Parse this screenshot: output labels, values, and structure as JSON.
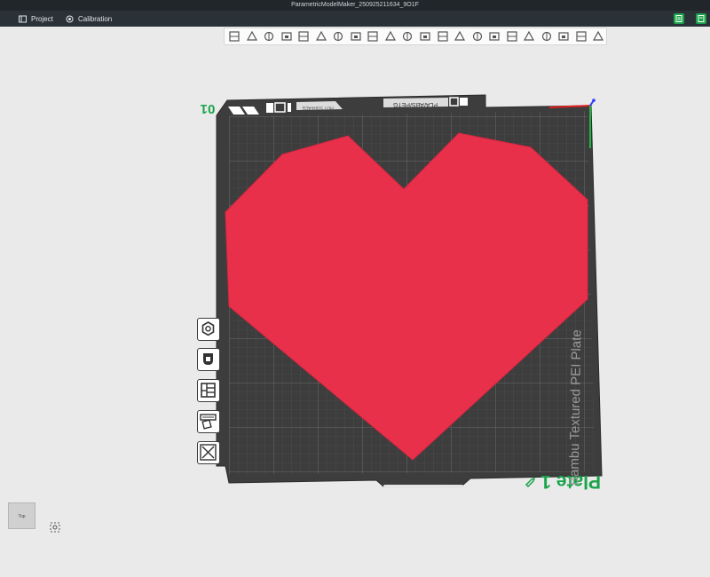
{
  "window": {
    "title": "ParametricModelMaker_250925211634_9O1F"
  },
  "menu": {
    "project_label": "Project",
    "calibration_label": "Calibration"
  },
  "colors": {
    "titlebar_bg": "#20262a",
    "menubar_bg": "#2b3237",
    "accent_green": "#1aa34a",
    "model_red": "#e8304b",
    "plate_dark": "#3d3d3d",
    "viewport_bg": "#eaeaea"
  },
  "toolbar": {
    "tools": [
      "add-object-icon",
      "add-plate-icon",
      "auto-orient-icon",
      "arrange-icon",
      "split-icon",
      "move-icon",
      "rotate-icon",
      "scale-icon",
      "lay-on-face-icon",
      "cut-icon",
      "boolean-icon",
      "support-paint-icon",
      "seam-paint-icon",
      "text-emboss-icon",
      "measure-icon",
      "assembly-icon",
      "fuzzy-skin-icon",
      "variable-layer-icon",
      "color-paint-icon",
      "mesh-edit-icon",
      "brim-ears-icon",
      "view-settings-icon"
    ]
  },
  "side_tools": [
    "outline-view-icon",
    "object-tool-icon",
    "layout-icon",
    "object-list-icon",
    "close-panel-icon"
  ],
  "plate": {
    "label": "Plate 1",
    "number": "01",
    "name": "Bambu Textured PEI Plate",
    "sticker_text": "PLA/ABS/PETG",
    "sticker_hot": "HOT SURFACE"
  },
  "view_cube": {
    "face_label": "Top"
  }
}
